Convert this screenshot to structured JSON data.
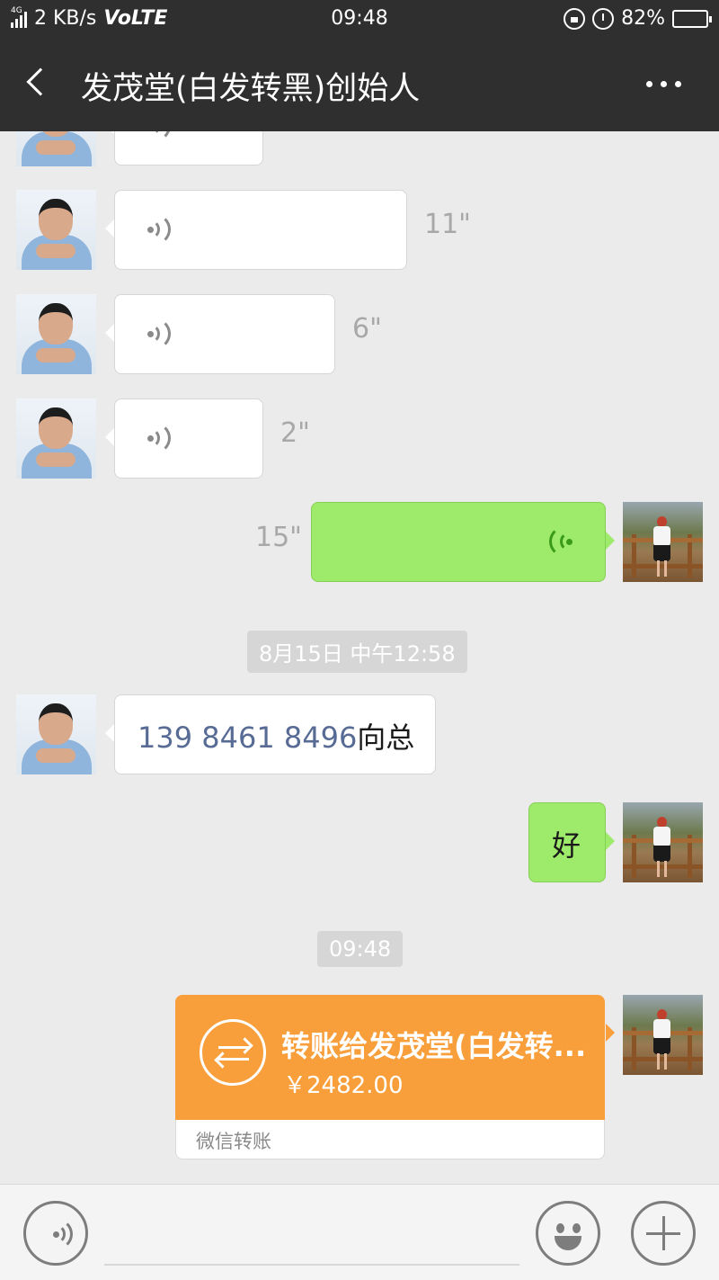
{
  "status_bar": {
    "net_type": "4G",
    "speed": "2 KB/s",
    "volte": "VoLTE",
    "time": "09:48",
    "battery": "82%",
    "battery_level": 0.82,
    "icons": [
      "signal-icon",
      "rotation-lock-icon",
      "alarm-icon",
      "battery-icon"
    ]
  },
  "header": {
    "title": "发茂堂(白发转黑)创始人",
    "back_icon": "chevron-left-icon",
    "more_icon": "more-dots-icon"
  },
  "messages": [
    {
      "type": "voice",
      "sender": "contact",
      "duration": ""
    },
    {
      "type": "voice",
      "sender": "contact",
      "duration": "11\""
    },
    {
      "type": "voice",
      "sender": "contact",
      "duration": "6\""
    },
    {
      "type": "voice",
      "sender": "contact",
      "duration": "2\""
    },
    {
      "type": "voice",
      "sender": "me",
      "duration": "15\""
    },
    {
      "type": "timestamp",
      "text": "8月15日 中午12:58"
    },
    {
      "type": "text",
      "sender": "contact",
      "phone": "139 8461 8496",
      "text": "向总"
    },
    {
      "type": "text",
      "sender": "me",
      "text": "好"
    },
    {
      "type": "timestamp",
      "text": "09:48"
    },
    {
      "type": "transfer",
      "sender": "me",
      "title": "转账给发茂堂(白发转...",
      "amount": "￥2482.00",
      "label": "微信转账"
    }
  ],
  "input_bar": {
    "voice_icon": "voice-input-icon",
    "emoji_icon": "emoji-icon",
    "plus_icon": "plus-icon"
  },
  "colors": {
    "header_bg": "#2f2f2f",
    "chat_bg": "#ebebeb",
    "my_bubble": "#9eea6a",
    "transfer": "#f89f3b",
    "link": "#576b95"
  }
}
